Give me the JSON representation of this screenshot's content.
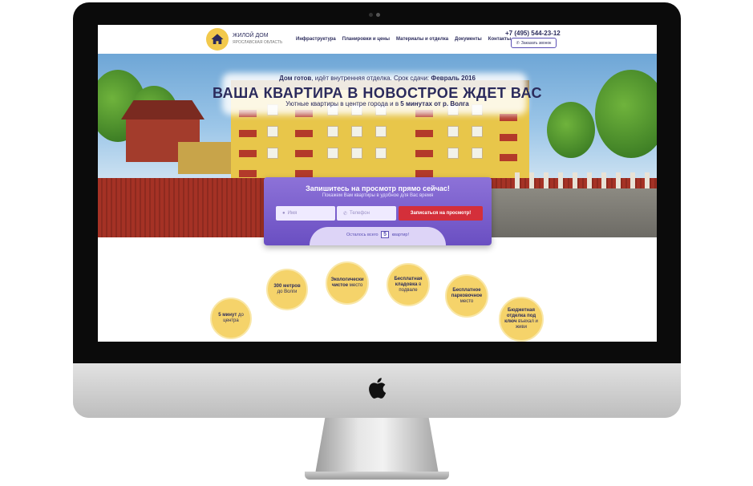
{
  "site": {
    "brand_name": "ЖИЛОЙ ДОМ",
    "brand_sub": "ЯРОСЛАВСКАЯ ОБЛАСТЬ",
    "nav": [
      "Инфраструктура",
      "Планировки и цены",
      "Материалы и отделка",
      "Документы",
      "Контакты"
    ],
    "phone": "+7 (495) 544-23-12",
    "call_button": "Заказать звонок"
  },
  "hero": {
    "line1_prefix": "Дом готов",
    "line1_middle": ", идёт внутренняя отделка. Срок сдачи: ",
    "line1_date": "Февраль 2016",
    "headline": "ВАША КВАРТИРА В НОВОСТРОЕ ЖДЕТ ВАС",
    "subline_prefix": "Уютные квартиры в центре города и в ",
    "subline_bold": "5 минутах от р. Волга"
  },
  "form": {
    "title": "Запишитесь на просмотр прямо сейчас!",
    "subtitle": "Покажем Вам квартиры в удобное для Вас время",
    "name_placeholder": "Имя",
    "phone_placeholder": "Телефон",
    "submit": "Записаться на просмотр!",
    "left_prefix": "Осталось всего",
    "left_count": "5",
    "left_suffix": "квартир!"
  },
  "features": [
    {
      "bold": "5 минут",
      "rest": "до центра"
    },
    {
      "bold": "300 метров",
      "rest": "до Волги"
    },
    {
      "bold": "Экологически чистое",
      "rest": "место"
    },
    {
      "bold": "Бесплатная кладовка",
      "rest": "в подвале"
    },
    {
      "bold": "Бесплатное парковочное",
      "rest": "место"
    },
    {
      "bold": "Бюджетная отделка под ключ",
      "rest": "въехал и живи"
    }
  ]
}
